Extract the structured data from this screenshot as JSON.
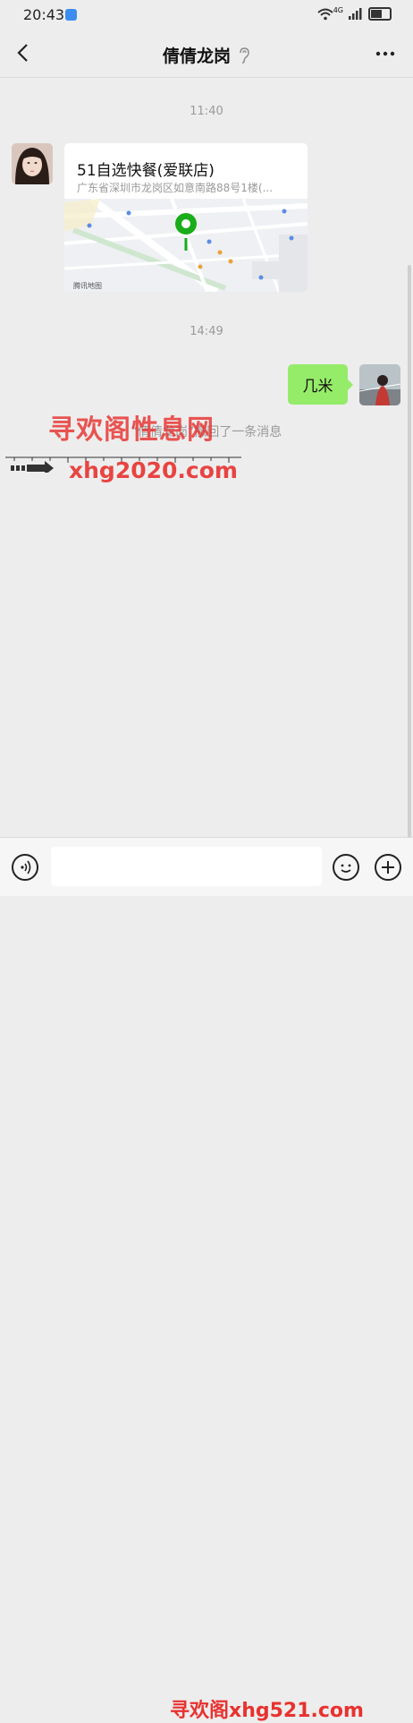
{
  "status_bar": {
    "time": "20:43",
    "network": "4G",
    "icons": [
      "wifi-icon",
      "signal-icon",
      "battery-icon"
    ]
  },
  "header": {
    "title": "倩倩龙岗",
    "back_icon": "chevron-left-icon",
    "earpiece_icon": "ear-icon",
    "more_icon": "more-icon"
  },
  "messages": [
    {
      "type": "timestamp",
      "text": "11:40"
    },
    {
      "type": "location",
      "from": "other",
      "name": "51自选快餐(爱联店)",
      "address": "广东省深圳市龙岗区如意南路88号1楼(...",
      "map_provider": "腾讯地图"
    },
    {
      "type": "timestamp",
      "text": "14:49"
    },
    {
      "type": "text",
      "from": "me",
      "text": "几米"
    },
    {
      "type": "recall",
      "text": "“倩倩龙岗”撤回了一条消息"
    }
  ],
  "watermarks": {
    "line1": "寻欢阁性息网",
    "line2": "xhg2020.com",
    "bottom": "寻欢阁xhg521.com"
  },
  "input_bar": {
    "voice_icon": "voice-icon",
    "placeholder": "",
    "emoji_icon": "emoji-icon",
    "plus_icon": "plus-icon"
  },
  "colors": {
    "background": "#ededed",
    "my_bubble": "#95ec69",
    "watermark": "#e8322f",
    "map_pin": "#1aad19"
  }
}
